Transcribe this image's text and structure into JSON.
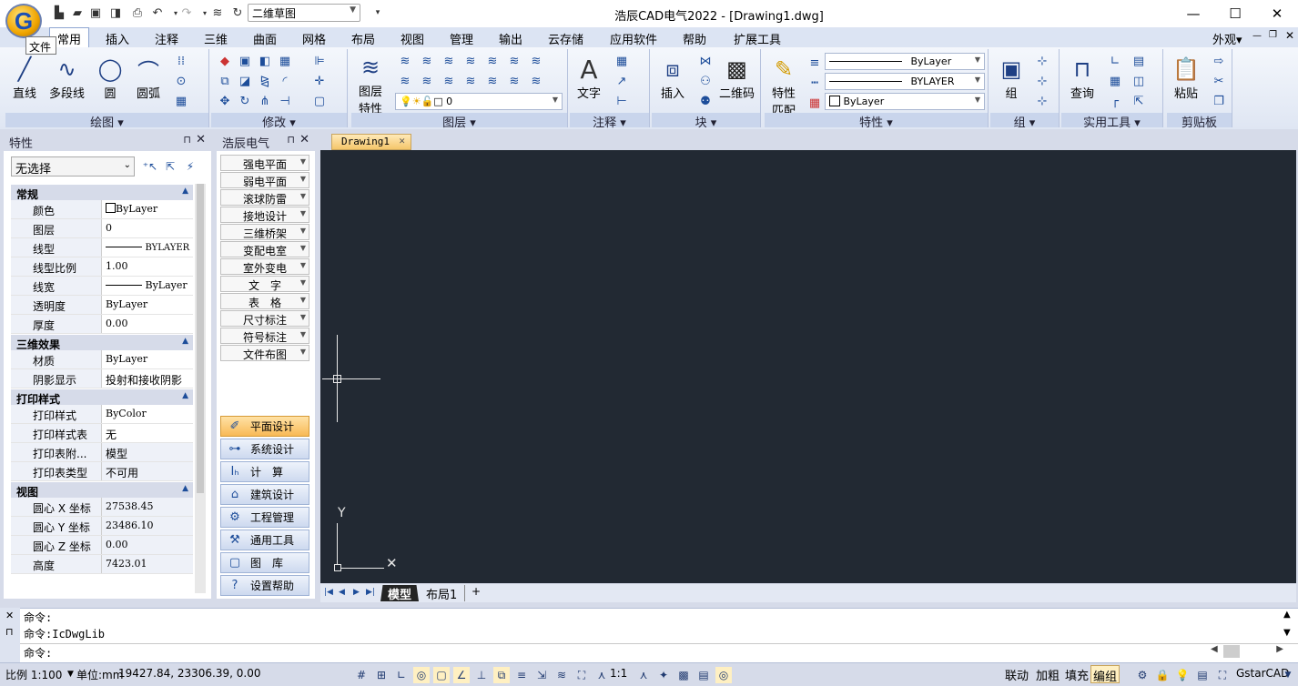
{
  "title_bar": {
    "app_title": "浩辰CAD电气2022 - [Drawing1.dwg]",
    "workspace": "二维草图",
    "tooltip": "文件"
  },
  "menus": [
    "常用",
    "插入",
    "注释",
    "三维",
    "曲面",
    "网格",
    "布局",
    "视图",
    "管理",
    "输出",
    "云存储",
    "应用软件",
    "帮助",
    "扩展工具"
  ],
  "menu_right": {
    "appearance": "外观"
  },
  "ribbon": {
    "draw": {
      "label": "绘图",
      "line": "直线",
      "polyline": "多段线",
      "circle": "圆",
      "arc": "圆弧"
    },
    "modify": {
      "label": "修改"
    },
    "layer": {
      "label": "图层",
      "props_l1": "图层",
      "props_l2": "特性",
      "current": "0"
    },
    "annotate": {
      "label": "注释",
      "text": "文字"
    },
    "block": {
      "label": "块",
      "insert": "插入",
      "qrcode": "二维码"
    },
    "properties": {
      "label": "特性",
      "match_l1": "特性",
      "match_l2": "匹配",
      "color": "ByLayer",
      "linetype": "BYLAYER",
      "lineweight": "ByLayer"
    },
    "group": {
      "label": "组",
      "group": "组"
    },
    "utilities": {
      "label": "实用工具",
      "query": "查询"
    },
    "clipboard": {
      "label": "剪贴板",
      "paste": "粘贴"
    }
  },
  "props_panel": {
    "title": "特性",
    "selection": "无选择",
    "general": {
      "header": "常规",
      "rows": [
        {
          "k": "颜色",
          "v": "ByLayer"
        },
        {
          "k": "图层",
          "v": "0"
        },
        {
          "k": "线型",
          "v": "BYLAYER"
        },
        {
          "k": "线型比例",
          "v": "1.00"
        },
        {
          "k": "线宽",
          "v": "ByLayer"
        },
        {
          "k": "透明度",
          "v": "ByLayer"
        },
        {
          "k": "厚度",
          "v": "0.00"
        }
      ]
    },
    "effects3d": {
      "header": "三维效果",
      "rows": [
        {
          "k": "材质",
          "v": "ByLayer"
        },
        {
          "k": "阴影显示",
          "v": "投射和接收阴影"
        }
      ]
    },
    "plotstyle": {
      "header": "打印样式",
      "rows": [
        {
          "k": "打印样式",
          "v": "ByColor"
        },
        {
          "k": "打印样式表",
          "v": "无"
        },
        {
          "k": "打印表附...",
          "v": "模型"
        },
        {
          "k": "打印表类型",
          "v": "不可用"
        }
      ]
    },
    "view": {
      "header": "视图",
      "rows": [
        {
          "k": "圆心 X 坐标",
          "v": "27538.45"
        },
        {
          "k": "圆心 Y 坐标",
          "v": "23486.10"
        },
        {
          "k": "圆心 Z 坐标",
          "v": "0.00"
        },
        {
          "k": "高度",
          "v": "7423.01"
        }
      ]
    }
  },
  "elec_panel": {
    "title": "浩辰电气",
    "items": [
      "强电平面",
      "弱电平面",
      "滚球防雷",
      "接地设计",
      "三维桥架",
      "变配电室",
      "室外变电",
      "文　字",
      "表　格",
      "尺寸标注",
      "符号标注",
      "文件布图"
    ],
    "nav": [
      "平面设计",
      "系统设计",
      "计　算",
      "建筑设计",
      "工程管理",
      "通用工具",
      "图　库",
      "设置帮助"
    ]
  },
  "drawing": {
    "tab": "Drawing1",
    "axis_y": "Y",
    "axis_x": "X"
  },
  "layout_tabs": [
    "模型",
    "布局1",
    "+"
  ],
  "command": {
    "lines": [
      "命令:",
      "命令:IcDwgLib"
    ],
    "prompt": "命令:"
  },
  "status": {
    "scale": "比例 1:100",
    "unit": "单位:mm",
    "coords": "19427.84, 23306.39, 0.00",
    "annot_scale": "1:1",
    "buttons": [
      "联动",
      "加粗",
      "填充",
      "编组"
    ],
    "app": "GstarCAD"
  }
}
